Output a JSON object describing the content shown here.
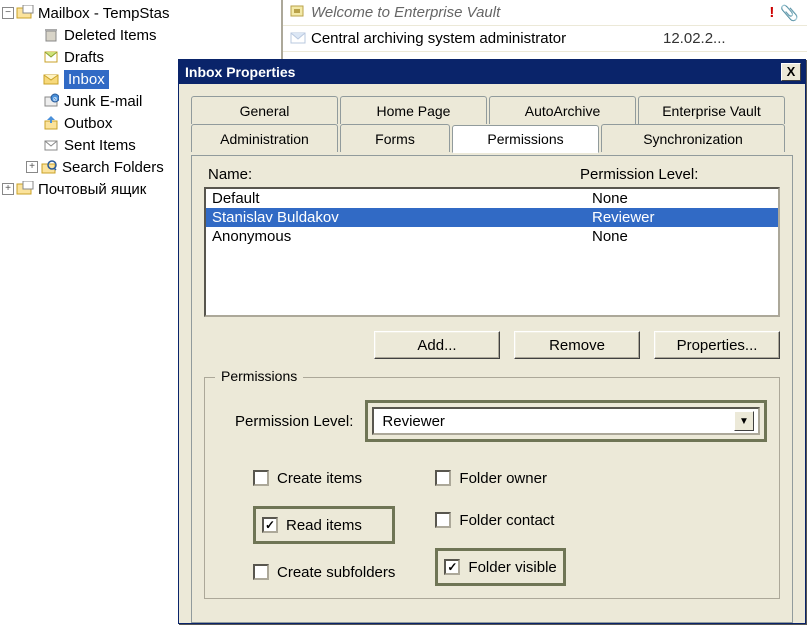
{
  "tree": {
    "mailbox_label": "Mailbox - TempStas",
    "items": [
      {
        "label": "Deleted Items"
      },
      {
        "label": "Drafts"
      },
      {
        "label": "Inbox",
        "selected": true
      },
      {
        "label": "Junk E-mail"
      },
      {
        "label": "Outbox"
      },
      {
        "label": "Sent Items"
      },
      {
        "label": "Search Folders"
      }
    ],
    "mailbox2_label": "Почтовый ящик"
  },
  "messages": {
    "welcome": "Welcome to Enterprise Vault",
    "row2_text": "Central archiving system administrator",
    "row2_date": "12.02.2...",
    "flag_glyph": "!",
    "clip_glyph": "📎"
  },
  "dialog": {
    "title": "Inbox Properties",
    "close_glyph": "X",
    "tabs_row1": [
      "General",
      "Home Page",
      "AutoArchive",
      "Enterprise Vault"
    ],
    "tabs_row2": [
      "Administration",
      "Forms",
      "Permissions",
      "Synchronization"
    ],
    "active_tab": "Permissions",
    "name_hdr": "Name:",
    "perm_hdr": "Permission Level:",
    "perm_list": [
      {
        "name": "Default",
        "level": "None"
      },
      {
        "name": "Stanislav Buldakov",
        "level": "Reviewer",
        "selected": true
      },
      {
        "name": "Anonymous",
        "level": "None"
      }
    ],
    "btn_add": "Add...",
    "btn_remove": "Remove",
    "btn_props": "Properties...",
    "group_legend": "Permissions",
    "perm_level_label": "Permission Level:",
    "perm_level_value": "Reviewer",
    "checks_left": [
      {
        "label": "Create items",
        "checked": false
      },
      {
        "label": "Read items",
        "checked": true,
        "highlight": true
      },
      {
        "label": "Create subfolders",
        "checked": false
      }
    ],
    "checks_right": [
      {
        "label": "Folder owner",
        "checked": false
      },
      {
        "label": "Folder contact",
        "checked": false
      },
      {
        "label": "Folder visible",
        "checked": true,
        "highlight": true
      }
    ]
  }
}
